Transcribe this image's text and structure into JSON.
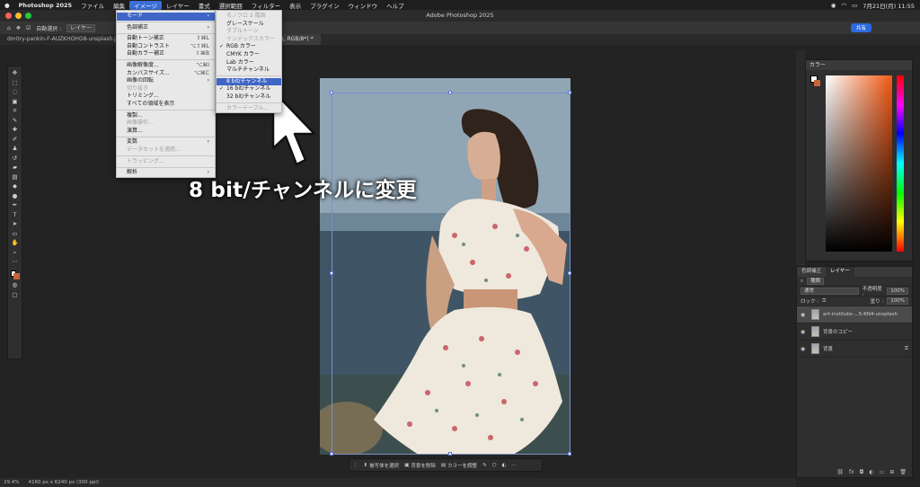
{
  "macbar": {
    "app": "Photoshop 2025",
    "items": [
      "ファイル",
      "編集",
      "イメージ",
      "レイヤー",
      "書式",
      "選択範囲",
      "フィルター",
      "表示",
      "プラグイン",
      "ウィンドウ",
      "ヘルプ"
    ],
    "active_index": 2,
    "datetime": "7月21日(月) 11:55"
  },
  "titlebar": {
    "title": "Adobe Photoshop 2025"
  },
  "optionsbar": {
    "auto_select_label": "自動選択 :",
    "auto_select_value": "レイヤー",
    "share_label": "共有"
  },
  "tabs": [
    {
      "label": "dmitry-pankin-F-AUZKHOHG8-unsplash.jpg",
      "active": false
    },
    {
      "label": "ドレス.psd @ 33.3% (レイヤー 1, RGB/8*) *",
      "active": true
    }
  ],
  "menu_image": {
    "items": [
      {
        "label": "モード",
        "arrow": true,
        "state": "hl"
      },
      {
        "sep": true
      },
      {
        "label": "色調補正",
        "arrow": true
      },
      {
        "sep": true
      },
      {
        "label": "自動トーン補正",
        "shortcut": "⇧⌘L"
      },
      {
        "label": "自動コントラスト",
        "shortcut": "⌥⇧⌘L"
      },
      {
        "label": "自動カラー補正",
        "shortcut": "⇧⌘B"
      },
      {
        "sep": true
      },
      {
        "label": "画像解像度...",
        "shortcut": "⌥⌘I"
      },
      {
        "label": "カンバスサイズ...",
        "shortcut": "⌥⌘C"
      },
      {
        "label": "画像の回転",
        "arrow": true
      },
      {
        "label": "切り抜き",
        "state": "dis"
      },
      {
        "label": "トリミング..."
      },
      {
        "label": "すべての領域を表示"
      },
      {
        "sep": true
      },
      {
        "label": "複製..."
      },
      {
        "label": "画像操作...",
        "state": "dis"
      },
      {
        "label": "演算..."
      },
      {
        "sep": true
      },
      {
        "label": "変数",
        "arrow": true
      },
      {
        "label": "データセットを適用...",
        "state": "dis"
      },
      {
        "sep": true
      },
      {
        "label": "トラッピング...",
        "state": "dis"
      },
      {
        "sep": true
      },
      {
        "label": "解析",
        "arrow": true
      }
    ]
  },
  "menu_mode": {
    "items": [
      {
        "label": "モノクロ 2 階調",
        "state": "dis"
      },
      {
        "label": "グレースケール"
      },
      {
        "label": "ダブルトーン",
        "state": "dis"
      },
      {
        "label": "インデックスカラー",
        "state": "dis"
      },
      {
        "label": "RGB カラー",
        "check": true
      },
      {
        "label": "CMYK カラー"
      },
      {
        "label": "Lab カラー"
      },
      {
        "label": "マルチチャンネル"
      },
      {
        "sep": true
      },
      {
        "label": "8 bit/チャンネル",
        "state": "hl"
      },
      {
        "label": "16 bit/チャンネル",
        "check": true
      },
      {
        "label": "32 bit/チャンネル"
      },
      {
        "sep": true
      },
      {
        "label": "カラーテーブル...",
        "state": "dis"
      }
    ]
  },
  "caption": "8 bit/チャンネルに変更",
  "contextbar": {
    "select_subject": "被写体を選択",
    "remove_bg": "背景を削除",
    "adjust_color": "カラーを調整"
  },
  "status": {
    "zoom": "29.4%",
    "size": "4160 px x 6240 px (300 ppi)"
  },
  "color_panel": {
    "title": "カラー"
  },
  "layers_panel": {
    "tab1": "色調補正",
    "tab2": "レイヤー",
    "filter": "種類",
    "blend": "通常",
    "opacity_label": "不透明度 :",
    "opacity": "100%",
    "lock_label": "ロック :",
    "fill_label": "塗り :",
    "fill": "100%",
    "layers": [
      {
        "name": "art-institute-...5-KN4-unsplash",
        "selected": true
      },
      {
        "name": "背景のコピー",
        "selected": false
      },
      {
        "name": "背景",
        "selected": false,
        "locked": true
      }
    ]
  }
}
